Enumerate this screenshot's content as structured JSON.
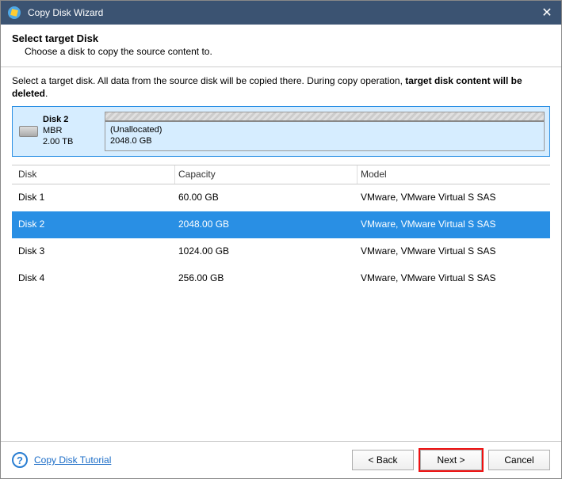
{
  "window": {
    "title": "Copy Disk Wizard"
  },
  "header": {
    "title": "Select target Disk",
    "subtitle": "Choose a disk to copy the source content to."
  },
  "warning": {
    "prefix": "Select a target disk. All data from the source disk will be copied there. During copy operation, ",
    "bold": "target disk content will be deleted",
    "suffix": "."
  },
  "preview": {
    "name": "Disk 2",
    "style": "MBR",
    "size": "2.00 TB",
    "partition_label": "(Unallocated)",
    "partition_size": "2048.0 GB"
  },
  "table": {
    "headers": {
      "disk": "Disk",
      "capacity": "Capacity",
      "model": "Model"
    },
    "rows": [
      {
        "disk": "Disk 1",
        "capacity": "60.00 GB",
        "model": "VMware, VMware Virtual S SAS",
        "selected": false
      },
      {
        "disk": "Disk 2",
        "capacity": "2048.00 GB",
        "model": "VMware, VMware Virtual S SAS",
        "selected": true
      },
      {
        "disk": "Disk 3",
        "capacity": "1024.00 GB",
        "model": "VMware, VMware Virtual S SAS",
        "selected": false
      },
      {
        "disk": "Disk 4",
        "capacity": "256.00 GB",
        "model": "VMware, VMware Virtual S SAS",
        "selected": false
      }
    ]
  },
  "footer": {
    "help_link": "Copy Disk Tutorial",
    "back": "< Back",
    "next": "Next >",
    "cancel": "Cancel"
  }
}
